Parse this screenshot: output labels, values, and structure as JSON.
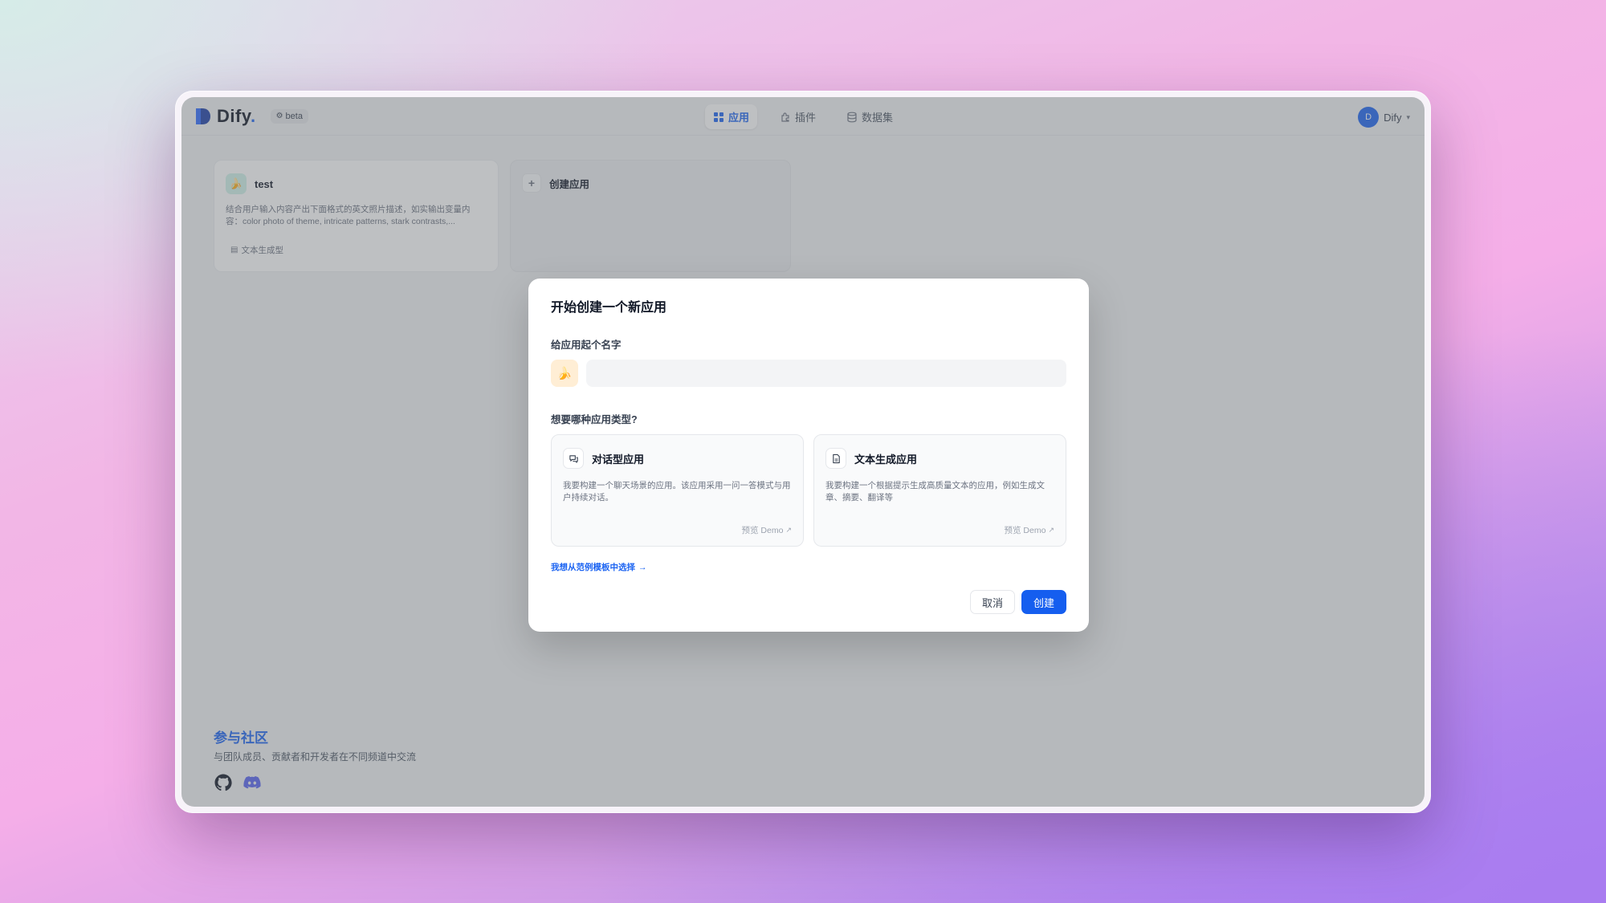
{
  "topbar": {
    "logo_text": "Dify",
    "logo_dot": ".",
    "beta_label": "beta",
    "nav": [
      {
        "label": "应用",
        "icon": "grid-icon"
      },
      {
        "label": "插件",
        "icon": "puzzle-icon"
      },
      {
        "label": "数据集",
        "icon": "database-icon"
      }
    ],
    "user": {
      "initial": "D",
      "name": "Dify"
    }
  },
  "apps": [
    {
      "icon": "🍌",
      "name": "test",
      "description": "结合用户输入内容产出下面格式的英文照片描述，如实输出变量内容：color photo of theme, intricate patterns, stark contrasts,...",
      "tag": "文本生成型"
    }
  ],
  "create_card": {
    "label": "创建应用"
  },
  "community": {
    "title": "参与社区",
    "subtitle": "与团队成员、贡献者和开发者在不同频道中交流"
  },
  "modal": {
    "title": "开始创建一个新应用",
    "name_label": "给应用起个名字",
    "emoji": "🍌",
    "name_value": "",
    "name_placeholder": "",
    "type_label": "想要哪种应用类型?",
    "types": [
      {
        "title": "对话型应用",
        "description": "我要构建一个聊天场景的应用。该应用采用一问一答模式与用户持续对话。",
        "demo": "预览 Demo"
      },
      {
        "title": "文本生成应用",
        "description": "我要构建一个根据提示生成高质量文本的应用，例如生成文章、摘要、翻译等",
        "demo": "预览 Demo"
      }
    ],
    "template_link": "我想从范例模板中选择",
    "cancel_label": "取消",
    "create_label": "创建"
  },
  "colors": {
    "accent": "#155eef",
    "link": "#1c64f2"
  }
}
